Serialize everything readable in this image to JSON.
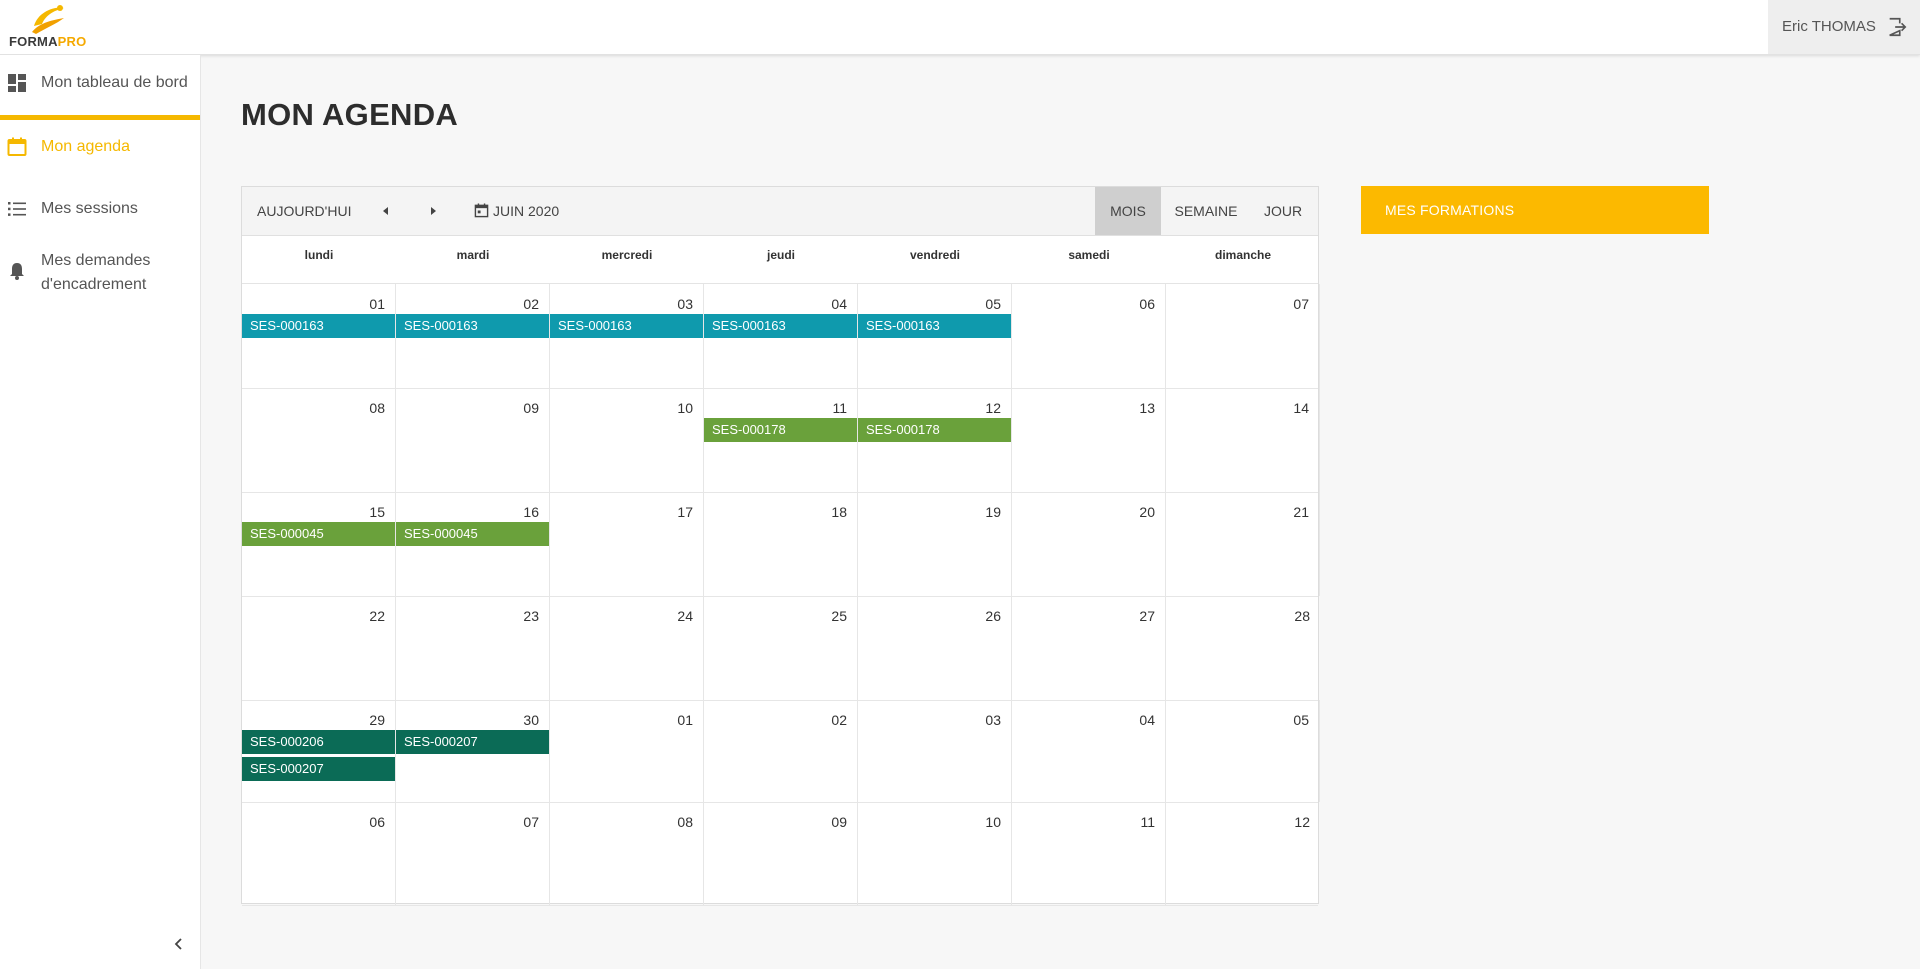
{
  "app": {
    "logo_part1": "FORMA",
    "logo_part2": "PRO",
    "user_name": "Eric THOMAS",
    "colors": {
      "accent": "#f5b800",
      "teal": "#0f9aad",
      "green": "#6aa13b",
      "dark_green": "#0b6b56"
    }
  },
  "sidebar": {
    "items": [
      {
        "label": "Mon tableau de bord",
        "icon": "dashboard-icon"
      },
      {
        "label": "Mon agenda",
        "icon": "calendar-icon",
        "active": true
      },
      {
        "label": "Mes sessions",
        "icon": "list-icon"
      },
      {
        "label": "Mes demandes",
        "label2": "d'encadrement",
        "icon": "bell-icon"
      }
    ]
  },
  "page": {
    "title": "MON AGENDA"
  },
  "calendar": {
    "today_label": "AUJOURD'HUI",
    "month_label": "JUIN 2020",
    "views": [
      "MOIS",
      "SEMAINE",
      "JOUR"
    ],
    "active_view": "MOIS",
    "days_of_week": [
      "lundi",
      "mardi",
      "mercredi",
      "jeudi",
      "vendredi",
      "samedi",
      "dimanche"
    ],
    "weeks": [
      {
        "days": [
          "01",
          "02",
          "03",
          "04",
          "05",
          "06",
          "07"
        ],
        "events": [
          {
            "day": 0,
            "label": "SES-000163",
            "color": "#0f9aad",
            "slot": 0
          },
          {
            "day": 1,
            "label": "SES-000163",
            "color": "#0f9aad",
            "slot": 0
          },
          {
            "day": 2,
            "label": "SES-000163",
            "color": "#0f9aad",
            "slot": 0
          },
          {
            "day": 3,
            "label": "SES-000163",
            "color": "#0f9aad",
            "slot": 0
          },
          {
            "day": 4,
            "label": "SES-000163",
            "color": "#0f9aad",
            "slot": 0
          }
        ]
      },
      {
        "days": [
          "08",
          "09",
          "10",
          "11",
          "12",
          "13",
          "14"
        ],
        "events": [
          {
            "day": 3,
            "label": "SES-000178",
            "color": "#6aa13b",
            "slot": 0
          },
          {
            "day": 4,
            "label": "SES-000178",
            "color": "#6aa13b",
            "slot": 0
          }
        ]
      },
      {
        "days": [
          "15",
          "16",
          "17",
          "18",
          "19",
          "20",
          "21"
        ],
        "events": [
          {
            "day": 0,
            "label": "SES-000045",
            "color": "#6aa13b",
            "slot": 0
          },
          {
            "day": 1,
            "label": "SES-000045",
            "color": "#6aa13b",
            "slot": 0
          }
        ]
      },
      {
        "days": [
          "22",
          "23",
          "24",
          "25",
          "26",
          "27",
          "28"
        ],
        "events": []
      },
      {
        "days": [
          "29",
          "30",
          "01",
          "02",
          "03",
          "04",
          "05"
        ],
        "events": [
          {
            "day": 0,
            "label": "SES-000206",
            "color": "#0b6b56",
            "slot": 0
          },
          {
            "day": 1,
            "label": "SES-000207",
            "color": "#0b6b56",
            "slot": 0
          },
          {
            "day": 0,
            "label": "SES-000207",
            "color": "#0b6b56",
            "slot": 1
          }
        ]
      },
      {
        "days": [
          "06",
          "07",
          "08",
          "09",
          "10",
          "11",
          "12"
        ],
        "events": []
      }
    ]
  },
  "formations": {
    "label": "MES FORMATIONS"
  }
}
